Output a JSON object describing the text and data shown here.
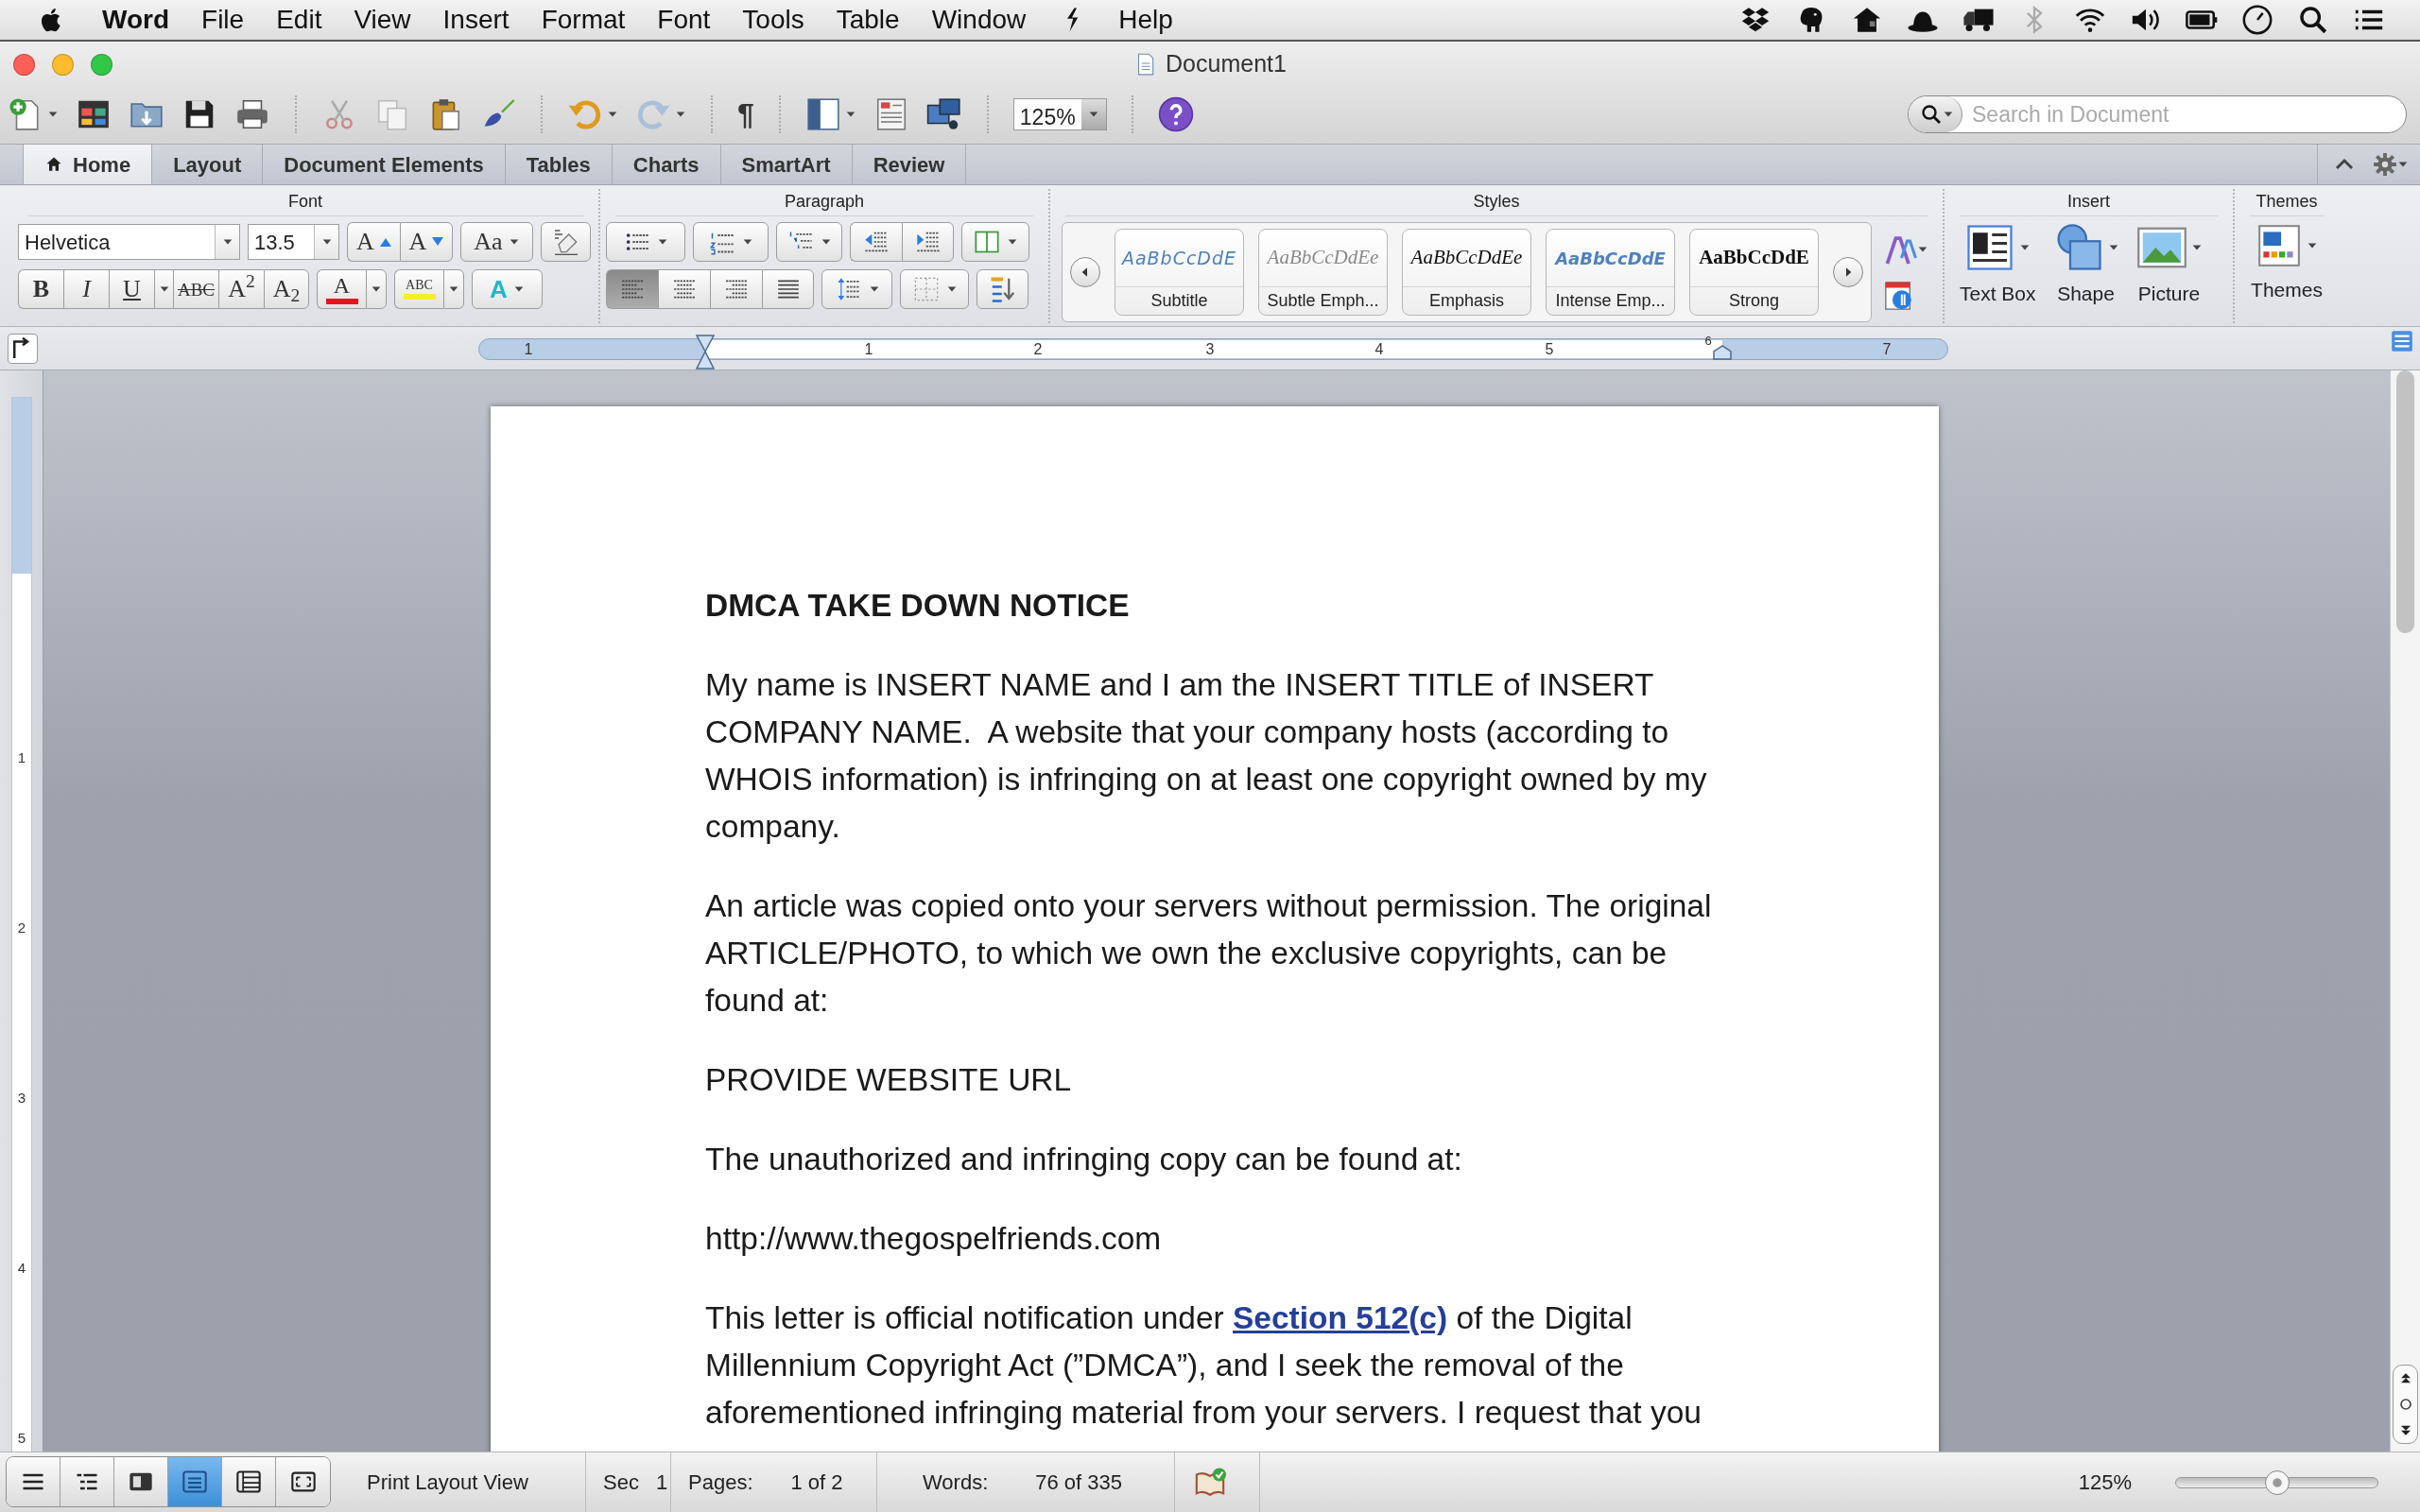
{
  "menu_bar": {
    "app_name": "Word",
    "items": [
      "File",
      "Edit",
      "View",
      "Insert",
      "Format",
      "Font",
      "Tools",
      "Table",
      "Window",
      "Help"
    ]
  },
  "window": {
    "title": "Document1"
  },
  "toolbar": {
    "paragraph_mark": "¶",
    "zoom": "125%",
    "search": {
      "placeholder": "Search in Document"
    }
  },
  "tabs": [
    {
      "label": "Home",
      "selected": true
    },
    {
      "label": "Layout",
      "selected": false
    },
    {
      "label": "Document Elements",
      "selected": false
    },
    {
      "label": "Tables",
      "selected": false
    },
    {
      "label": "Charts",
      "selected": false
    },
    {
      "label": "SmartArt",
      "selected": false
    },
    {
      "label": "Review",
      "selected": false
    }
  ],
  "ribbon": {
    "font": {
      "title": "Font",
      "font_name": "Helvetica",
      "font_size": "13.5",
      "grow": "A",
      "shrink": "A",
      "change_case": "Aa",
      "formats": [
        {
          "label": "B",
          "kind": "bold"
        },
        {
          "label": "I",
          "kind": "italic"
        },
        {
          "label": "U",
          "kind": "underline"
        },
        {
          "label": "ABC",
          "kind": "strike"
        },
        {
          "label": "A$^{2}$",
          "kind": "super"
        },
        {
          "label": "A$_{2}$",
          "kind": "sub"
        }
      ],
      "font_color": {
        "label": "A",
        "color": "#e8141b"
      },
      "highlight": {
        "label": "ABC",
        "color": "#f5ee2c"
      },
      "text_effects": "A"
    },
    "paragraph": {
      "title": "Paragraph",
      "alignments": [
        {
          "kind": "left",
          "selected": true
        },
        {
          "kind": "center",
          "selected": false
        },
        {
          "kind": "right",
          "selected": false
        },
        {
          "kind": "justify",
          "selected": false
        }
      ]
    },
    "styles": {
      "title": "Styles",
      "items": [
        {
          "preview": "AaBbCcDdE",
          "name": "Subtitle",
          "kind": "subtitle"
        },
        {
          "preview": "AaBbCcDdEe",
          "name": "Subtle Emph...",
          "kind": "subtle"
        },
        {
          "preview": "AaBbCcDdEe",
          "name": "Emphasis",
          "kind": "emphasis"
        },
        {
          "preview": "AaBbCcDdE",
          "name": "Intense Emp...",
          "kind": "intense"
        },
        {
          "preview": "AaBbCcDdE",
          "name": "Strong",
          "kind": "strong"
        }
      ]
    },
    "insert": {
      "title": "Insert",
      "items": [
        {
          "label": "Text Box",
          "kind": "text-box"
        },
        {
          "label": "Shape",
          "kind": "shape"
        },
        {
          "label": "Picture",
          "kind": "picture"
        }
      ]
    },
    "themes": {
      "title": "Themes",
      "label": "Themes"
    }
  },
  "ruler": {
    "labels": [
      "1",
      "1",
      "2",
      "3",
      "4",
      "5",
      "6",
      "7"
    ]
  },
  "vertical_ruler": {
    "labels": [
      "1",
      "2",
      "3",
      "4",
      "5"
    ]
  },
  "document": {
    "heading": "DMCA TAKE DOWN NOTICE",
    "paragraphs": [
      {
        "text": "My name is INSERT NAME and I am the INSERT TITLE of INSERT COMPANY NAME.  A website that your company hosts (according to WHOIS information) is infringing on at least one copyright owned by my company."
      },
      {
        "text": "An article was copied onto your servers without permission. The original ARTICLE/PHOTO, to which we own the exclusive copyrights, can be found at:"
      },
      {
        "text": "PROVIDE WEBSITE URL"
      },
      {
        "text": "The unauthorized and infringing copy can be found at:"
      },
      {
        "text": "http://www.thegospelfriends.com"
      },
      {
        "text": "This letter is official notification under ",
        "link": "Section 512(c)",
        "text_after": " of the Digital Millennium Copyright Act (”DMCA”), and I seek the removal of the aforementioned infringing material from your servers. I request that you"
      }
    ]
  },
  "status_bar": {
    "views": [
      {
        "kind": "draft",
        "selected": false
      },
      {
        "kind": "outline",
        "selected": false
      },
      {
        "kind": "publishing",
        "selected": false
      },
      {
        "kind": "print",
        "selected": true
      },
      {
        "kind": "notebook",
        "selected": false
      },
      {
        "kind": "focus",
        "selected": false
      }
    ],
    "view_name": "Print Layout View",
    "section_label": "Sec",
    "section": "1",
    "pages_label": "Pages:",
    "pages": "1 of 2",
    "words_label": "Words:",
    "words": "76 of 335",
    "zoom": "125%",
    "zoom_slider": {
      "level": 0.5
    }
  }
}
